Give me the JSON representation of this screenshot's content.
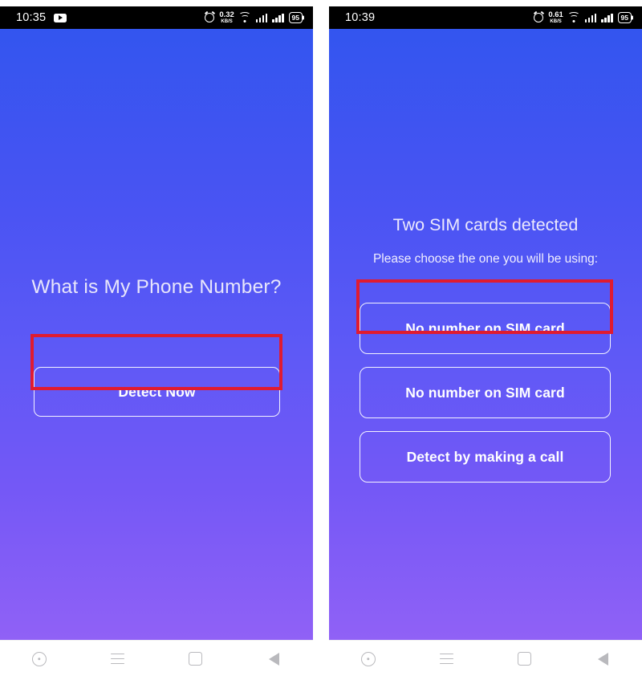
{
  "app": {
    "name": "What is My Phone Number",
    "accent_gradient_top": "#3355ef",
    "accent_gradient_bottom": "#9061f6",
    "annotation_color": "#e01b30"
  },
  "panels": [
    {
      "id": "left",
      "status_bar": {
        "clock": "10:35",
        "app_icon": "youtube-icon",
        "alarm_icon": "alarm-icon",
        "net_speed_value": "0.32",
        "net_speed_unit": "KB/S",
        "wifi_icon": "wifi-icon",
        "signal_icon_1": "signal-bars-icon",
        "signal_icon_2": "signal-bars-icon",
        "battery_level": "95"
      },
      "screen": {
        "headline": "What is My Phone Number?",
        "primary_button": "Detect Now"
      },
      "nav_bar": {
        "assistant_label": "assistant",
        "recents_label": "recents",
        "home_label": "home",
        "back_label": "back"
      }
    },
    {
      "id": "right",
      "status_bar": {
        "clock": "10:39",
        "alarm_icon": "alarm-icon",
        "net_speed_value": "0.61",
        "net_speed_unit": "KB/S",
        "wifi_icon": "wifi-icon",
        "signal_icon_1": "signal-bars-icon",
        "signal_icon_2": "signal-bars-icon",
        "battery_level": "95"
      },
      "screen": {
        "title": "Two SIM cards detected",
        "subtitle": "Please choose the one you will be using:",
        "options": [
          "No number on SIM card",
          "No number on SIM card",
          "Detect by making a call"
        ]
      },
      "nav_bar": {
        "assistant_label": "assistant",
        "recents_label": "recents",
        "home_label": "home",
        "back_label": "back"
      }
    }
  ]
}
